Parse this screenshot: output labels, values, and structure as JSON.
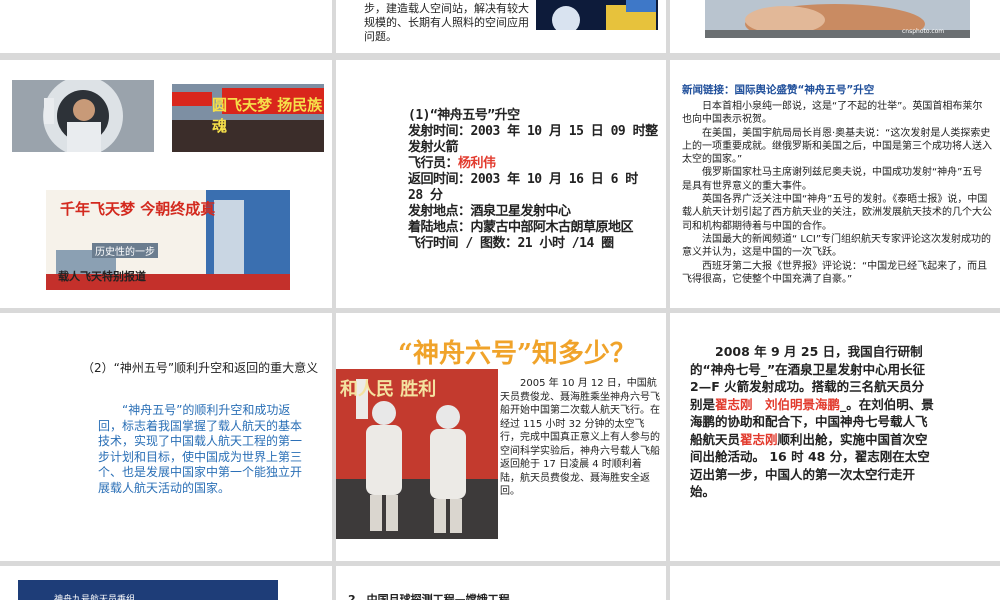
{
  "top_row": {
    "text_lines": [
      "步，建造载人空间站，解决有较大",
      "规模的、长期有人照料的空间应用",
      "问题。"
    ]
  },
  "shenzhou5_launch": {
    "heading": "(1)“神舟五号”升空",
    "rows": [
      {
        "label": "发射时间：",
        "value": "2003 年 10 月 15 日 09 时整发射火箭"
      },
      {
        "label": "飞行员：",
        "value": "杨利伟",
        "value_red": true
      },
      {
        "label": "返回时间：",
        "value": "2003 年 10 月 16 日 6 时 28 分"
      },
      {
        "label": "发射地点：",
        "value": "酒泉卫星发射中心"
      },
      {
        "label": "着陆地点：",
        "value": "内蒙古中部阿木古朗草原地区"
      },
      {
        "label": "飞行时间 / 图数：",
        "value": "21 小时 /14 圈"
      }
    ]
  },
  "photos": {
    "banner_text": "圆飞天梦 扬民族魂",
    "newspaper_headline": "千年飞天梦 今朝终成真",
    "newspaper_sub": "历史性的一步",
    "newspaper_foot": "载人飞天特别报道",
    "overlay_text": "cnsphoto.com",
    "sz6_banner": "和人民 胜利"
  },
  "news": {
    "heading": "新闻链接：国际舆论盛赞“神舟五号”升空",
    "paragraphs": [
      "日本首相小泉纯一郎说，这是“了不起的壮举”。英国首相布莱尔也向中国表示祝贺。",
      "在美国，美国宇航局局长肖恩·奥基夫说：“这次发射是人类探索史上的一项重要成就。继俄罗斯和美国之后，中国是第三个成功将人送入太空的国家。”",
      "俄罗斯国家杜马主席谢列兹尼奥夫说，中国成功发射“神舟”五号是具有世界意义的重大事件。",
      "英国各界广泛关注中国“神舟”五号的发射。《泰晤士报》说，中国载人航天计划引起了西方航天业的关注，欧洲发展航天技术的几个大公司和机构都期待着与中国的合作。",
      "法国最大的新闻频道“ LCI”专门组织航天专家评论这次发射成功的意义并认为，这是中国的一次飞跃。",
      "西班牙第二大报《世界报》评论说：“中国龙已经飞起来了，而且飞得很高，它使整个中国充满了自豪。”"
    ]
  },
  "significance": {
    "title": "（2）“神州五号”顺利升空和返回的重大意义",
    "body": "“神舟五号”的顺利升空和成功返回，标志着我国掌握了载人航天的基本技术，实现了中国载人航天工程的第一步计划和目标，使中国成为世界上第三个、也是发展中国家中第一个能独立开展载人航天活动的国家。"
  },
  "shenzhou6": {
    "title": "“神舟六号”知多少？",
    "body": "2005 年 10 月 12 日，中国航天员费俊龙、聂海胜乘坐神舟六号飞船开始中国第二次载人航天飞行。在经过 115 小时 32 分钟的太空飞行，完成中国真正意义上有人参与的空间科学实验后，神舟六号载人飞船返回舱于 17 日凌晨 4 时顺利着陆，航天员费俊龙、聂海胜安全返回。"
  },
  "shenzhou7": {
    "part1": "2008 年 9 月 25 日，我国自行研制的“神舟七号_”在酒泉卫星发射中心用长征 2—F 火箭发射成功。搭载的三名航天员分别是",
    "names1": "翟志刚　刘伯明景海鹏",
    "part2": "_。在刘伯明、景海鹏的协助和配合下，中国神舟七号载人飞船航天员",
    "names2": "翟志刚",
    "part3": "顺利出舱，实施中国首次空间出舱活动。 16 时 48 分，翟志刚在太空迈出第一步，中国人的第一次太空行走开始。"
  },
  "bottom_row": {
    "blue_box_text": "神舟九号航天员乘组",
    "moon_title": "2、中国月球探测工程—嫦娥工程"
  },
  "colors": {
    "background": "#d9d9d9",
    "slide": "#ffffff",
    "accent_red": "#e23b2e",
    "news_blue": "#1e4e9a",
    "body_blue": "#2a6fb6",
    "title_orange": "#f0a32a"
  }
}
